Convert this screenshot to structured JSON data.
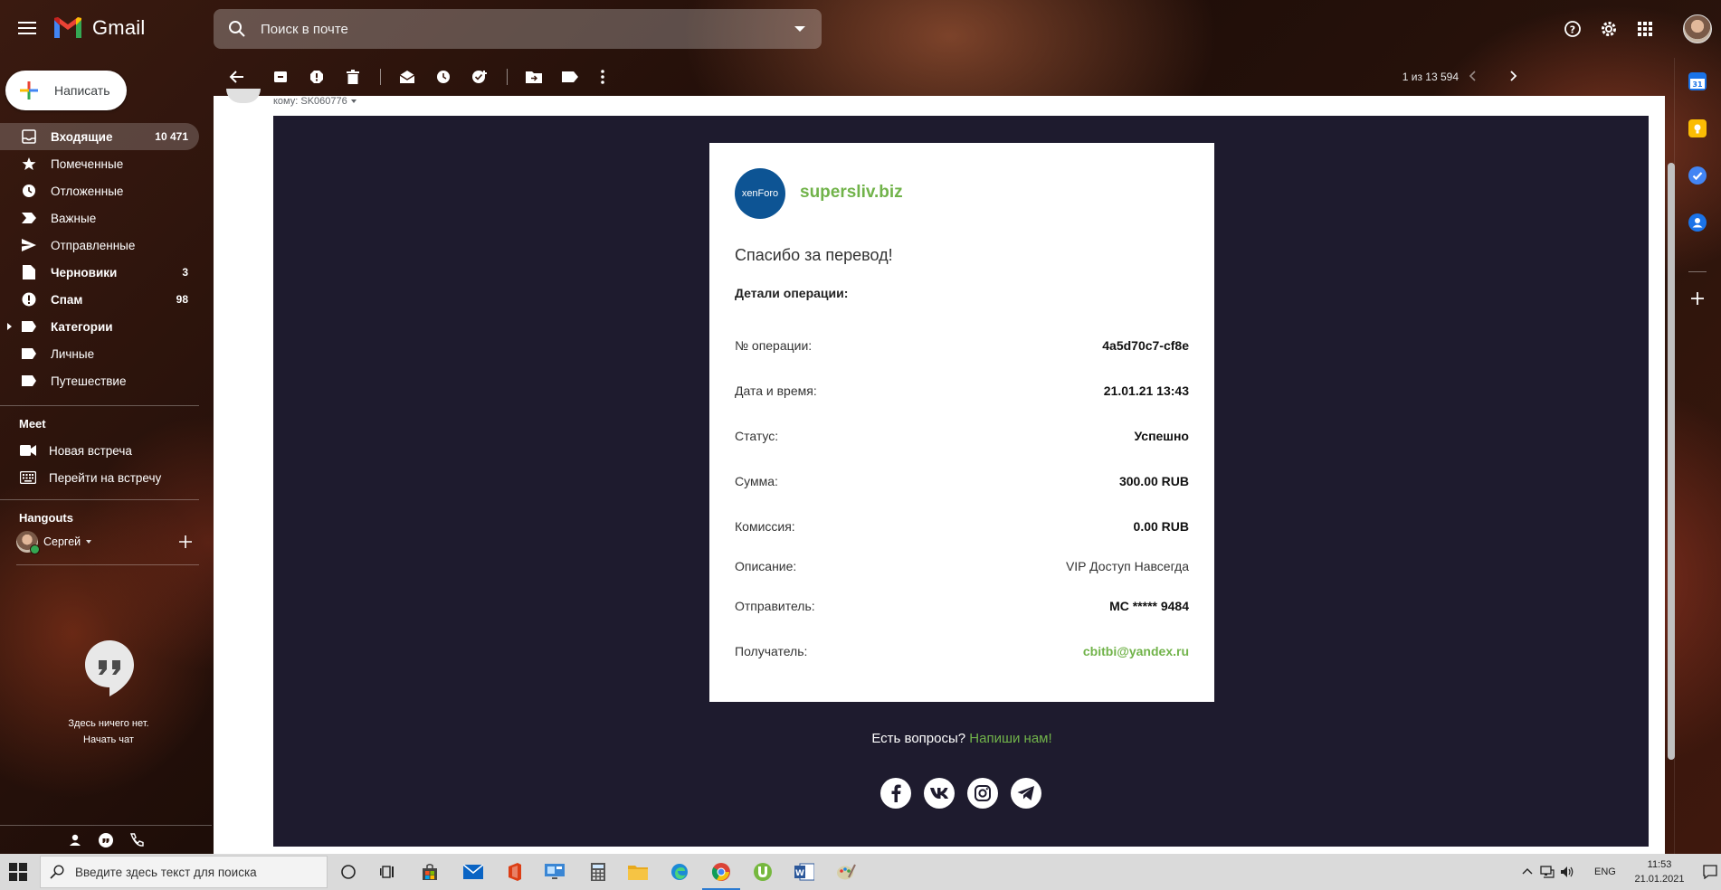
{
  "app": {
    "name": "Gmail"
  },
  "search": {
    "placeholder": "Поиск в почте"
  },
  "compose": {
    "label": "Написать"
  },
  "pager": {
    "text": "1 из 13 594"
  },
  "nav": {
    "items": [
      {
        "label": "Входящие",
        "count": "10 471"
      },
      {
        "label": "Помеченные",
        "count": ""
      },
      {
        "label": "Отложенные",
        "count": ""
      },
      {
        "label": "Важные",
        "count": ""
      },
      {
        "label": "Отправленные",
        "count": ""
      },
      {
        "label": "Черновики",
        "count": "3"
      },
      {
        "label": "Спам",
        "count": "98"
      },
      {
        "label": "Категории",
        "count": ""
      },
      {
        "label": "Личные",
        "count": ""
      },
      {
        "label": "Путешествие",
        "count": ""
      }
    ]
  },
  "meet": {
    "title": "Meet",
    "new_meeting": "Новая встреча",
    "join_meeting": "Перейти на встречу"
  },
  "hangouts": {
    "title": "Hangouts",
    "user": "Сергей",
    "empty_text": "Здесь ничего нет.",
    "start_chat": "Начать чат"
  },
  "message": {
    "to_label": "кому: SK060776"
  },
  "receipt": {
    "logo_text": "xenForo",
    "site": "supersliv.biz",
    "thanks": "Спасибо за перевод!",
    "details_title": "Детали операции:",
    "rows": [
      {
        "key": "№ операции:",
        "value": "4a5d70c7-cf8e"
      },
      {
        "key": "Дата и время:",
        "value": "21.01.21 13:43"
      },
      {
        "key": "Статус:",
        "value": "Успешно"
      },
      {
        "key": "Сумма:",
        "value": "300.00 RUB"
      },
      {
        "key": "Комиссия:",
        "value": "0.00 RUB"
      },
      {
        "key": "Описание:",
        "value": "VIP Доступ Навсегда"
      },
      {
        "key": "Отправитель:",
        "value": "MC ***** 9484"
      },
      {
        "key": "Получатель:",
        "value": "cbitbi@yandex.ru"
      }
    ],
    "questions": "Есть вопросы?",
    "contact_link": "Напиши нам!"
  },
  "taskbar": {
    "search_placeholder": "Введите здесь текст для поиска",
    "lang": "ENG",
    "time": "11:53",
    "date": "21.01.2021"
  },
  "colors": {
    "accent_green": "#71b34a",
    "email_bg": "#1e1b2e",
    "logo_blue": "#0d5494"
  }
}
